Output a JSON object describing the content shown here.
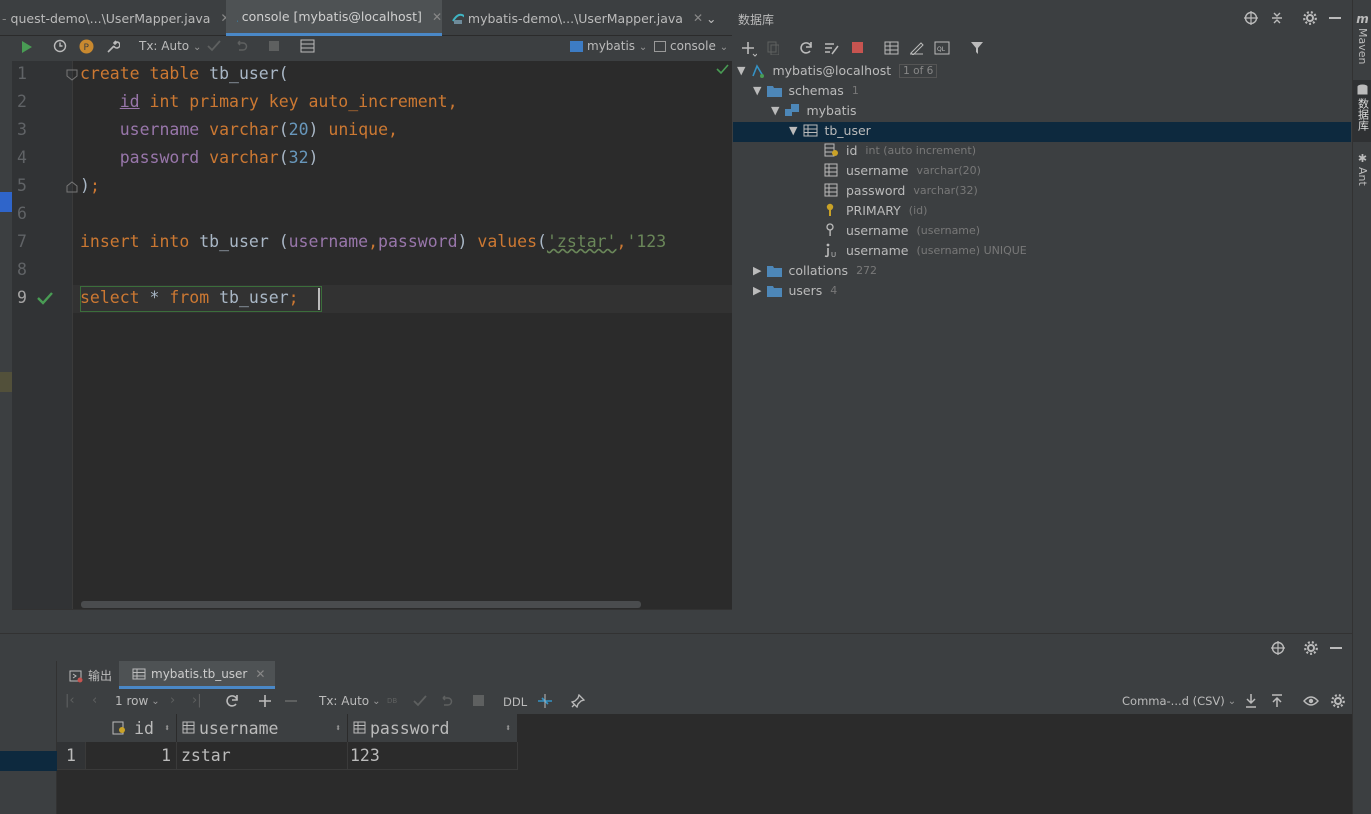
{
  "tabs": [
    {
      "label": "quest-demo\\...\\UserMapper.java"
    },
    {
      "label": "console [mybatis@localhost]"
    },
    {
      "label": "mybatis-demo\\...\\UserMapper.java"
    }
  ],
  "editor_toolbar": {
    "tx_mode": "Tx: Auto",
    "datasource": "mybatis",
    "session": "console"
  },
  "editor": {
    "line_numbers": [
      "1",
      "2",
      "3",
      "4",
      "5",
      "6",
      "7",
      "8",
      "9"
    ],
    "lines": [
      [
        {
          "t": "kw",
          "v": "create table "
        },
        {
          "t": "pl",
          "v": "tb_user("
        }
      ],
      [
        {
          "t": "pl",
          "v": "    "
        },
        {
          "t": "id",
          "v": "id"
        },
        {
          "t": "kw",
          "v": " int primary key auto_increment,"
        }
      ],
      [
        {
          "t": "pl",
          "v": "    "
        },
        {
          "t": "id",
          "v": "username"
        },
        {
          "t": "kw",
          "v": " varchar"
        },
        {
          "t": "pl",
          "v": "("
        },
        {
          "t": "num",
          "v": "20"
        },
        {
          "t": "pl",
          "v": ") "
        },
        {
          "t": "kw",
          "v": "unique,"
        }
      ],
      [
        {
          "t": "pl",
          "v": "    "
        },
        {
          "t": "id",
          "v": "password"
        },
        {
          "t": "kw",
          "v": " varchar"
        },
        {
          "t": "pl",
          "v": "("
        },
        {
          "t": "num",
          "v": "32"
        },
        {
          "t": "pl",
          "v": ")"
        }
      ],
      [
        {
          "t": "pl",
          "v": ")"
        },
        {
          "t": "kw",
          "v": ";"
        }
      ],
      [],
      [
        {
          "t": "kw",
          "v": "insert into "
        },
        {
          "t": "pl",
          "v": "tb_user ("
        },
        {
          "t": "id",
          "v": "username"
        },
        {
          "t": "kw",
          "v": ","
        },
        {
          "t": "id",
          "v": "password"
        },
        {
          "t": "pl",
          "v": ") "
        },
        {
          "t": "kw",
          "v": "values"
        },
        {
          "t": "pl",
          "v": "("
        },
        {
          "t": "str",
          "v": "'zstar'"
        },
        {
          "t": "kw",
          "v": ","
        },
        {
          "t": "str",
          "v": "'123"
        }
      ],
      [],
      [
        {
          "t": "kw",
          "v": "select "
        },
        {
          "t": "pl",
          "v": "* "
        },
        {
          "t": "kw",
          "v": "from "
        },
        {
          "t": "pl",
          "v": "tb_user"
        },
        {
          "t": "kw",
          "v": ";"
        }
      ]
    ]
  },
  "db_panel": {
    "title": "数据库",
    "tree": {
      "connection": {
        "label": "mybatis@localhost",
        "badge": "1 of 6"
      },
      "schemas": {
        "label": "schemas",
        "count": "1"
      },
      "schema": {
        "label": "mybatis"
      },
      "table": {
        "label": "tb_user"
      },
      "columns": [
        {
          "name": "id",
          "meta": "int (auto increment)",
          "icon": "key-column-icon"
        },
        {
          "name": "username",
          "meta": "varchar(20)",
          "icon": "column-icon"
        },
        {
          "name": "password",
          "meta": "varchar(32)",
          "icon": "column-icon"
        },
        {
          "name": "PRIMARY",
          "meta": "(id)",
          "icon": "primary-key-icon"
        },
        {
          "name": "username",
          "meta": "(username)",
          "icon": "index-icon"
        },
        {
          "name": "username",
          "meta": "(username) UNIQUE",
          "icon": "unique-index-icon"
        }
      ],
      "collations": {
        "label": "collations",
        "count": "272"
      },
      "users": {
        "label": "users",
        "count": "4"
      }
    }
  },
  "right_strip": [
    "Maven",
    "数据库",
    "Ant"
  ],
  "results": {
    "tabs": [
      {
        "label": "输出"
      },
      {
        "label": "mybatis.tb_user"
      }
    ],
    "toolbar": {
      "rows": "1 row",
      "tx_mode": "Tx: Auto",
      "ddl": "DDL",
      "export_format": "Comma-...d (CSV)"
    },
    "columns": [
      "id",
      "username",
      "password"
    ],
    "rows": [
      {
        "row_num": "1",
        "id": "1",
        "username": "zstar",
        "password": "123"
      }
    ]
  },
  "colors": {
    "keyword": "#cc7832",
    "field": "#9876aa",
    "number": "#6897bb",
    "string": "#6a8759",
    "selection": "#0d293e",
    "panel": "#3c3f41",
    "editor_bg": "#2b2b2b"
  }
}
